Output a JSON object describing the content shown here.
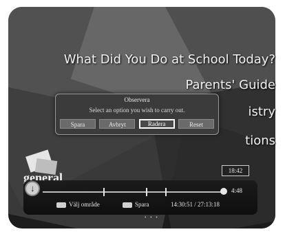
{
  "menu": {
    "items": [
      "What Did You Do at School Today?",
      "Parents' Guide",
      "istry",
      "tions"
    ]
  },
  "dialog": {
    "title": "Observera",
    "message": "Select an option you wish to carry out.",
    "buttons": [
      "Spara",
      "Avbryt",
      "Radera",
      "Reset"
    ],
    "selected": "Radera"
  },
  "channel_logo_text": "general",
  "time_box": "18:42",
  "playback": {
    "elapsed": "4:48",
    "progress_percent": 96,
    "clock": "14:30:51 / 27:13:18",
    "key_hints": [
      "Välj område",
      "Spara"
    ]
  },
  "icons": [
    "play-disc-icon",
    "track-knob-icon",
    "remote-key-icon"
  ],
  "colors": {
    "background": "#1c1c1c",
    "text": "#f2f2f2",
    "selected_border": "#ffffff"
  }
}
